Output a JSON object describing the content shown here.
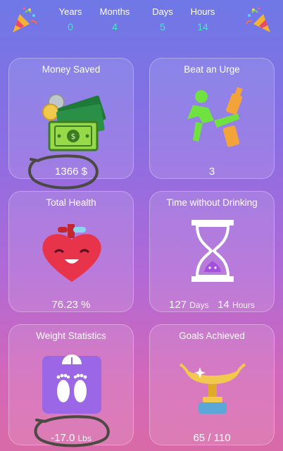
{
  "stats": [
    {
      "label": "Years",
      "value": "0"
    },
    {
      "label": "Months",
      "value": "4"
    },
    {
      "label": "Days",
      "value": "5"
    },
    {
      "label": "Hours",
      "value": "14"
    }
  ],
  "cards": {
    "money": {
      "title": "Money Saved",
      "value": "1366 $"
    },
    "urge": {
      "title": "Beat an Urge",
      "value": "3"
    },
    "health": {
      "title": "Total Health",
      "value": "76.23 %"
    },
    "time": {
      "title": "Time without Drinking",
      "days": "127",
      "days_unit": "Days",
      "hours": "14",
      "hours_unit": "Hours"
    },
    "weight": {
      "title": "Weight Statistics",
      "value": "-17.0",
      "unit": "Lbs"
    },
    "goals": {
      "title": "Goals Achieved",
      "value": "65 / 110"
    }
  },
  "colors": {
    "stat_value": "#4ee0d0",
    "annotation": "#4a4a42"
  },
  "icons": [
    "party-popper-icon",
    "money-stack-icon",
    "kick-bottle-icon",
    "heart-icon",
    "hourglass-icon",
    "scale-footprints-icon",
    "trophy-lamp-icon"
  ]
}
